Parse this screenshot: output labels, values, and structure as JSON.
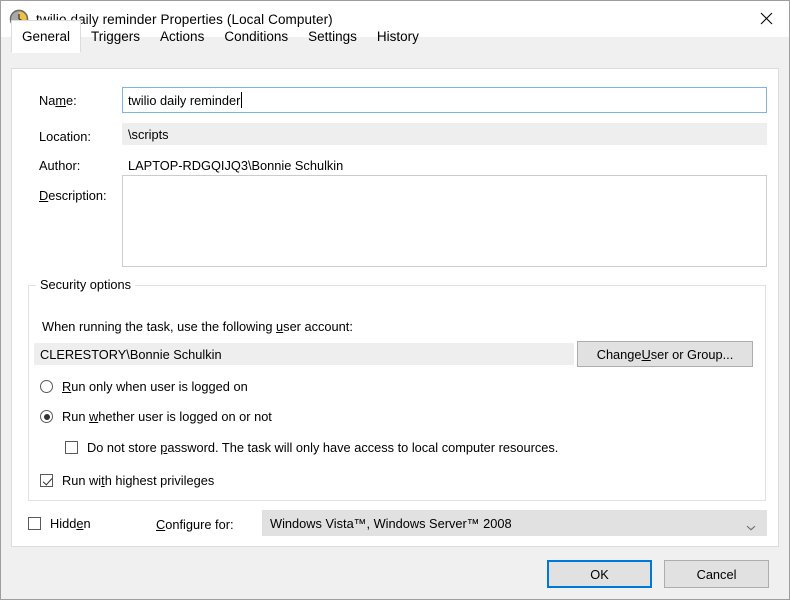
{
  "window": {
    "title": "twilio daily reminder Properties (Local Computer)",
    "icon": "clock-icon",
    "close_label": "✕"
  },
  "tabs": [
    {
      "label": "General",
      "active": true
    },
    {
      "label": "Triggers",
      "active": false
    },
    {
      "label": "Actions",
      "active": false
    },
    {
      "label": "Conditions",
      "active": false
    },
    {
      "label": "Settings",
      "active": false
    },
    {
      "label": "History",
      "active": false
    }
  ],
  "general": {
    "name_label_pre": "Na",
    "name_label_accel": "m",
    "name_label_post": "e:",
    "name_value": "twilio daily reminder",
    "location_label": "Location:",
    "location_value": "\\scripts",
    "author_label": "Author:",
    "author_value": "LAPTOP-RDGQIJQ3\\Bonnie Schulkin",
    "description_label_accel": "D",
    "description_label_post": "escription:",
    "description_value": ""
  },
  "security": {
    "group_title": "Security options",
    "account_prompt_pre": "When running the task, use the following ",
    "account_prompt_accel": "u",
    "account_prompt_post": "ser account:",
    "account_value": "CLERESTORY\\Bonnie Schulkin",
    "change_user_pre": "Change ",
    "change_user_accel": "U",
    "change_user_post": "ser or Group...",
    "radio_logged_on_pre": "",
    "radio_logged_on_accel": "R",
    "radio_logged_on_post": "un only when user is logged on",
    "radio_logged_on_checked": false,
    "radio_whether_pre": "Run ",
    "radio_whether_accel": "w",
    "radio_whether_post": "hether user is logged on or not",
    "radio_whether_checked": true,
    "check_nopassword_pre": "Do not store ",
    "check_nopassword_accel": "p",
    "check_nopassword_post": "assword.  The task will only have access to local computer resources.",
    "check_nopassword_checked": false,
    "check_highest_pre": "Run wi",
    "check_highest_accel": "t",
    "check_highest_post": "h highest privileges",
    "check_highest_checked": true
  },
  "bottom": {
    "hidden_pre": "Hidd",
    "hidden_accel": "e",
    "hidden_post": "n",
    "hidden_checked": false,
    "configure_label_accel": "C",
    "configure_label_post": "onfigure for:",
    "configure_value": "Windows Vista™, Windows Server™ 2008",
    "configure_arrow": "chevron-down-icon"
  },
  "footer": {
    "ok_label": "OK",
    "cancel_label": "Cancel"
  },
  "colors": {
    "dialog_bg": "#f0f0f0",
    "panel_bg": "#ffffff",
    "focus_border": "#7eb4e2",
    "default_btn_border": "#0078d7",
    "readonly_bg": "#eeeeee",
    "control_bg": "#e1e1e1"
  }
}
